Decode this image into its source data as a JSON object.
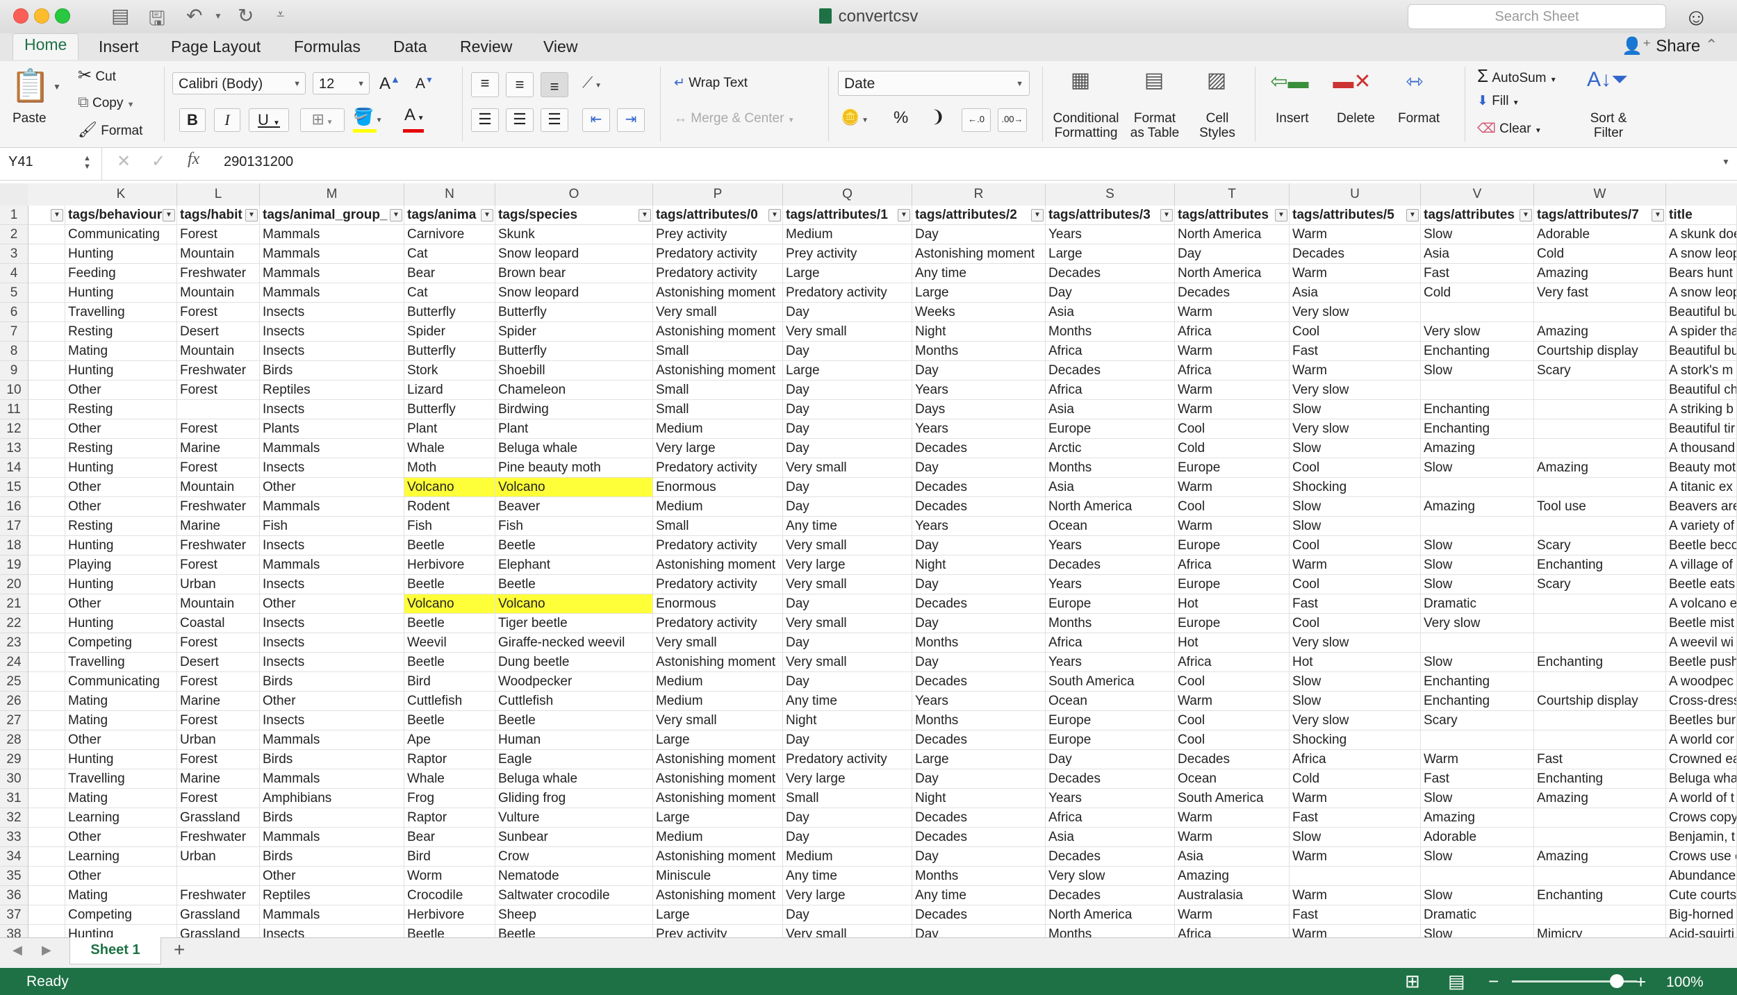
{
  "window": {
    "title": "convertcsv",
    "search_placeholder": "Search Sheet",
    "share_label": "Share"
  },
  "tabs": [
    "Home",
    "Insert",
    "Page Layout",
    "Formulas",
    "Data",
    "Review",
    "View"
  ],
  "ribbon": {
    "paste": "Paste",
    "cut": "Cut",
    "copy": "Copy",
    "format_painter": "Format",
    "font_name": "Calibri (Body)",
    "font_size": "12",
    "wrap_text": "Wrap Text",
    "merge_center": "Merge & Center",
    "number_format": "Date",
    "conditional_formatting": [
      "Conditional",
      "Formatting"
    ],
    "format_as_table": [
      "Format",
      "as Table"
    ],
    "cell_styles": [
      "Cell",
      "Styles"
    ],
    "insert": "Insert",
    "delete": "Delete",
    "format": "Format",
    "autosum": "AutoSum",
    "fill": "Fill",
    "clear": "Clear",
    "sort_filter": [
      "Sort &",
      "Filter"
    ]
  },
  "formula_bar": {
    "name_box": "Y41",
    "fx": "fx",
    "value": "290131200"
  },
  "grid": {
    "columns": [
      "K",
      "L",
      "M",
      "N",
      "O",
      "P",
      "Q",
      "R",
      "S",
      "T",
      "U",
      "V",
      "W",
      ""
    ],
    "header_row": [
      "tags/behaviour",
      "tags/habit",
      "tags/animal_group_",
      "tags/anima",
      "tags/species",
      "tags/attributes/0",
      "tags/attributes/1",
      "tags/attributes/2",
      "tags/attributes/3",
      "tags/attributes",
      "tags/attributes/5",
      "tags/attributes",
      "tags/attributes/7",
      "title"
    ],
    "rows": [
      {
        "n": "2",
        "c": [
          "Communicating",
          "Forest",
          "Mammals",
          "Carnivore",
          "Skunk",
          "Prey activity",
          "Medium",
          "Day",
          "Years",
          "North America",
          "Warm",
          "Slow",
          "Adorable",
          "A skunk doe"
        ]
      },
      {
        "n": "3",
        "c": [
          "Hunting",
          "Mountain",
          "Mammals",
          "Cat",
          "Snow leopard",
          "Predatory activity",
          "Prey activity",
          "Astonishing moment",
          "Large",
          "Day",
          "Decades",
          "Asia",
          "Cold",
          "A snow leop"
        ]
      },
      {
        "n": "4",
        "c": [
          "Feeding",
          "Freshwater",
          "Mammals",
          "Bear",
          "Brown bear",
          "Predatory activity",
          "Large",
          "Any time",
          "Decades",
          "North America",
          "Warm",
          "Fast",
          "Amazing",
          "Bears hunt"
        ]
      },
      {
        "n": "5",
        "c": [
          "Hunting",
          "Mountain",
          "Mammals",
          "Cat",
          "Snow leopard",
          "Astonishing moment",
          "Predatory activity",
          "Large",
          "Day",
          "Decades",
          "Asia",
          "Cold",
          "Very fast",
          "A snow leop"
        ]
      },
      {
        "n": "6",
        "c": [
          "Travelling",
          "Forest",
          "Insects",
          "Butterfly",
          "Butterfly",
          "Very small",
          "Day",
          "Weeks",
          "Asia",
          "Warm",
          "Very slow",
          "",
          "",
          "Beautiful bu"
        ]
      },
      {
        "n": "7",
        "c": [
          "Resting",
          "Desert",
          "Insects",
          "Spider",
          "Spider",
          "Astonishing moment",
          "Very small",
          "Night",
          "Months",
          "Africa",
          "Cool",
          "Very slow",
          "Amazing",
          "A spider tha"
        ]
      },
      {
        "n": "8",
        "c": [
          "Mating",
          "Mountain",
          "Insects",
          "Butterfly",
          "Butterfly",
          "Small",
          "Day",
          "Months",
          "Africa",
          "Warm",
          "Fast",
          "Enchanting",
          "Courtship display",
          "Beautiful bu"
        ]
      },
      {
        "n": "9",
        "c": [
          "Hunting",
          "Freshwater",
          "Birds",
          "Stork",
          "Shoebill",
          "Astonishing moment",
          "Large",
          "Day",
          "Decades",
          "Africa",
          "Warm",
          "Slow",
          "Scary",
          "A stork's m"
        ]
      },
      {
        "n": "10",
        "c": [
          "Other",
          "Forest",
          "Reptiles",
          "Lizard",
          "Chameleon",
          "Small",
          "Day",
          "Years",
          "Africa",
          "Warm",
          "Very slow",
          "",
          "",
          "Beautiful ch"
        ]
      },
      {
        "n": "11",
        "c": [
          "Resting",
          "",
          "Insects",
          "Butterfly",
          "Birdwing",
          "Small",
          "Day",
          "Days",
          "Asia",
          "Warm",
          "Slow",
          "Enchanting",
          "",
          "A striking b"
        ]
      },
      {
        "n": "12",
        "c": [
          "Other",
          "Forest",
          "Plants",
          "Plant",
          "Plant",
          "Medium",
          "Day",
          "Years",
          "Europe",
          "Cool",
          "Very slow",
          "Enchanting",
          "",
          "Beautiful tir"
        ]
      },
      {
        "n": "13",
        "c": [
          "Resting",
          "Marine",
          "Mammals",
          "Whale",
          "Beluga whale",
          "Very large",
          "Day",
          "Decades",
          "Arctic",
          "Cold",
          "Slow",
          "Amazing",
          "",
          "A thousand"
        ]
      },
      {
        "n": "14",
        "c": [
          "Hunting",
          "Forest",
          "Insects",
          "Moth",
          "Pine beauty moth",
          "Predatory activity",
          "Very small",
          "Day",
          "Months",
          "Europe",
          "Cool",
          "Slow",
          "Amazing",
          "Beauty mot"
        ]
      },
      {
        "n": "15",
        "c": [
          "Other",
          "Mountain",
          "Other",
          "Volcano",
          "Volcano",
          "Enormous",
          "Day",
          "Decades",
          "Asia",
          "Warm",
          "Shocking",
          "",
          "",
          "A titanic ex"
        ],
        "y": [
          3,
          4
        ]
      },
      {
        "n": "16",
        "c": [
          "Other",
          "Freshwater",
          "Mammals",
          "Rodent",
          "Beaver",
          "Medium",
          "Day",
          "Decades",
          "North America",
          "Cool",
          "Slow",
          "Amazing",
          "Tool use",
          "Beavers are"
        ]
      },
      {
        "n": "17",
        "c": [
          "Resting",
          "Marine",
          "Fish",
          "Fish",
          "Fish",
          "Small",
          "Any time",
          "Years",
          "Ocean",
          "Warm",
          "Slow",
          "",
          "",
          "A variety of"
        ]
      },
      {
        "n": "18",
        "c": [
          "Hunting",
          "Freshwater",
          "Insects",
          "Beetle",
          "Beetle",
          "Predatory activity",
          "Very small",
          "Day",
          "Years",
          "Europe",
          "Cool",
          "Slow",
          "Scary",
          "Beetle beco"
        ]
      },
      {
        "n": "19",
        "c": [
          "Playing",
          "Forest",
          "Mammals",
          "Herbivore",
          "Elephant",
          "Astonishing moment",
          "Very large",
          "Night",
          "Decades",
          "Africa",
          "Warm",
          "Slow",
          "Enchanting",
          "A village of"
        ]
      },
      {
        "n": "20",
        "c": [
          "Hunting",
          "Urban",
          "Insects",
          "Beetle",
          "Beetle",
          "Predatory activity",
          "Very small",
          "Day",
          "Years",
          "Europe",
          "Cool",
          "Slow",
          "Scary",
          "Beetle eats"
        ]
      },
      {
        "n": "21",
        "c": [
          "Other",
          "Mountain",
          "Other",
          "Volcano",
          "Volcano",
          "Enormous",
          "Day",
          "Decades",
          "Europe",
          "Hot",
          "Fast",
          "Dramatic",
          "",
          "A volcano e"
        ],
        "y": [
          3,
          4
        ]
      },
      {
        "n": "22",
        "c": [
          "Hunting",
          "Coastal",
          "Insects",
          "Beetle",
          "Tiger beetle",
          "Predatory activity",
          "Very small",
          "Day",
          "Months",
          "Europe",
          "Cool",
          "Very slow",
          "",
          "Beetle mist"
        ]
      },
      {
        "n": "23",
        "c": [
          "Competing",
          "Forest",
          "Insects",
          "Weevil",
          "Giraffe-necked weevil",
          "Very small",
          "Day",
          "Months",
          "Africa",
          "Hot",
          "Very slow",
          "",
          "",
          "A weevil wi"
        ]
      },
      {
        "n": "24",
        "c": [
          "Travelling",
          "Desert",
          "Insects",
          "Beetle",
          "Dung beetle",
          "Astonishing moment",
          "Very small",
          "Day",
          "Years",
          "Africa",
          "Hot",
          "Slow",
          "Enchanting",
          "Beetle push"
        ]
      },
      {
        "n": "25",
        "c": [
          "Communicating",
          "Forest",
          "Birds",
          "Bird",
          "Woodpecker",
          "Medium",
          "Day",
          "Decades",
          "South America",
          "Cool",
          "Slow",
          "Enchanting",
          "",
          "A woodpec"
        ]
      },
      {
        "n": "26",
        "c": [
          "Mating",
          "Marine",
          "Other",
          "Cuttlefish",
          "Cuttlefish",
          "Medium",
          "Any time",
          "Years",
          "Ocean",
          "Warm",
          "Slow",
          "Enchanting",
          "Courtship display",
          "Cross-dress"
        ]
      },
      {
        "n": "27",
        "c": [
          "Mating",
          "Forest",
          "Insects",
          "Beetle",
          "Beetle",
          "Very small",
          "Night",
          "Months",
          "Europe",
          "Cool",
          "Very slow",
          "Scary",
          "",
          "Beetles bur"
        ]
      },
      {
        "n": "28",
        "c": [
          "Other",
          "Urban",
          "Mammals",
          "Ape",
          "Human",
          "Large",
          "Day",
          "Decades",
          "Europe",
          "Cool",
          "Shocking",
          "",
          "",
          "A world cor"
        ]
      },
      {
        "n": "29",
        "c": [
          "Hunting",
          "Forest",
          "Birds",
          "Raptor",
          "Eagle",
          "Astonishing moment",
          "Predatory activity",
          "Large",
          "Day",
          "Decades",
          "Africa",
          "Warm",
          "Fast",
          "Crowned ea"
        ]
      },
      {
        "n": "30",
        "c": [
          "Travelling",
          "Marine",
          "Mammals",
          "Whale",
          "Beluga whale",
          "Astonishing moment",
          "Very large",
          "Day",
          "Decades",
          "Ocean",
          "Cold",
          "Fast",
          "Enchanting",
          "Beluga wha"
        ]
      },
      {
        "n": "31",
        "c": [
          "Mating",
          "Forest",
          "Amphibians",
          "Frog",
          "Gliding frog",
          "Astonishing moment",
          "Small",
          "Night",
          "Years",
          "South America",
          "Warm",
          "Slow",
          "Amazing",
          "A world of t"
        ]
      },
      {
        "n": "32",
        "c": [
          "Learning",
          "Grassland",
          "Birds",
          "Raptor",
          "Vulture",
          "Large",
          "Day",
          "Decades",
          "Africa",
          "Warm",
          "Fast",
          "Amazing",
          "",
          "Crows copy"
        ]
      },
      {
        "n": "33",
        "c": [
          "Other",
          "Freshwater",
          "Mammals",
          "Bear",
          "Sunbear",
          "Medium",
          "Day",
          "Decades",
          "Asia",
          "Warm",
          "Slow",
          "Adorable",
          "",
          "Benjamin, t"
        ]
      },
      {
        "n": "34",
        "c": [
          "Learning",
          "Urban",
          "Birds",
          "Bird",
          "Crow",
          "Astonishing moment",
          "Medium",
          "Day",
          "Decades",
          "Asia",
          "Warm",
          "Slow",
          "Amazing",
          "Crows use c"
        ]
      },
      {
        "n": "35",
        "c": [
          "Other",
          "",
          "Other",
          "Worm",
          "Nematode",
          "Miniscule",
          "Any time",
          "Months",
          "Very slow",
          "Amazing",
          "",
          "",
          "",
          "Abundance"
        ]
      },
      {
        "n": "36",
        "c": [
          "Mating",
          "Freshwater",
          "Reptiles",
          "Crocodile",
          "Saltwater crocodile",
          "Astonishing moment",
          "Very large",
          "Any time",
          "Decades",
          "Australasia",
          "Warm",
          "Slow",
          "Enchanting",
          "Cute courts"
        ]
      },
      {
        "n": "37",
        "c": [
          "Competing",
          "Grassland",
          "Mammals",
          "Herbivore",
          "Sheep",
          "Large",
          "Day",
          "Decades",
          "North America",
          "Warm",
          "Fast",
          "Dramatic",
          "",
          "Big-horned"
        ]
      },
      {
        "n": "38",
        "c": [
          "Hunting",
          "Grassland",
          "Insects",
          "Beetle",
          "Beetle",
          "Prey activity",
          "Very small",
          "Day",
          "Months",
          "Africa",
          "Warm",
          "Slow",
          "Mimicry",
          "Acid-squirti"
        ]
      }
    ]
  },
  "sheet_tabs": [
    "Sheet 1"
  ],
  "status": {
    "text": "Ready",
    "zoom": "100%",
    "zoom_level": 1.0,
    "accent": "#1e7145"
  }
}
